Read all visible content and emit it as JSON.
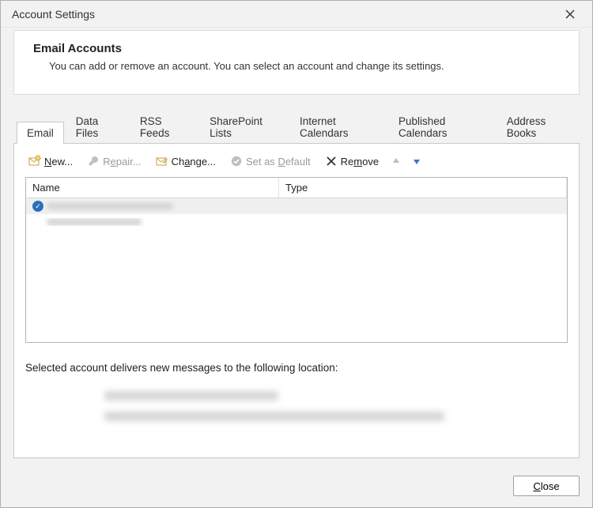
{
  "window": {
    "title": "Account Settings"
  },
  "intro": {
    "heading": "Email Accounts",
    "description": "You can add or remove an account. You can select an account and change its settings."
  },
  "tabs": [
    {
      "label": "Email",
      "active": true
    },
    {
      "label": "Data Files",
      "active": false
    },
    {
      "label": "RSS Feeds",
      "active": false
    },
    {
      "label": "SharePoint Lists",
      "active": false
    },
    {
      "label": "Internet Calendars",
      "active": false
    },
    {
      "label": "Published Calendars",
      "active": false
    },
    {
      "label": "Address Books",
      "active": false
    }
  ],
  "toolbar": {
    "new": {
      "label": "New...",
      "mnemonic": "N",
      "enabled": true,
      "icon": "mail-new-icon"
    },
    "repair": {
      "label": "Repair...",
      "mnemonic": "R",
      "enabled": false,
      "icon": "wrench-icon"
    },
    "change": {
      "label": "Change...",
      "mnemonic": "a",
      "enabled": true,
      "icon": "mail-change-icon"
    },
    "set_default": {
      "label": "Set as Default",
      "mnemonic": "D",
      "enabled": false,
      "icon": "check-circle-icon"
    },
    "remove": {
      "label": "Remove",
      "mnemonic": "m",
      "enabled": true,
      "icon": "x-icon"
    },
    "move_up": {
      "enabled": false,
      "icon": "arrow-up-icon"
    },
    "move_down": {
      "enabled": false,
      "icon": "arrow-down-icon"
    }
  },
  "list": {
    "columns": {
      "name": "Name",
      "type": "Type"
    },
    "rows": [
      {
        "name": "(redacted)",
        "type": "(redacted)",
        "is_default": true,
        "selected": true
      },
      {
        "name": "(redacted)",
        "type": "(redacted)",
        "is_default": false,
        "selected": false
      }
    ]
  },
  "delivery": {
    "label": "Selected account delivers new messages to the following location:",
    "location_display": "(redacted)",
    "data_file_display": "(redacted)"
  },
  "footer": {
    "close_label": "Close",
    "close_mnemonic": "C"
  }
}
